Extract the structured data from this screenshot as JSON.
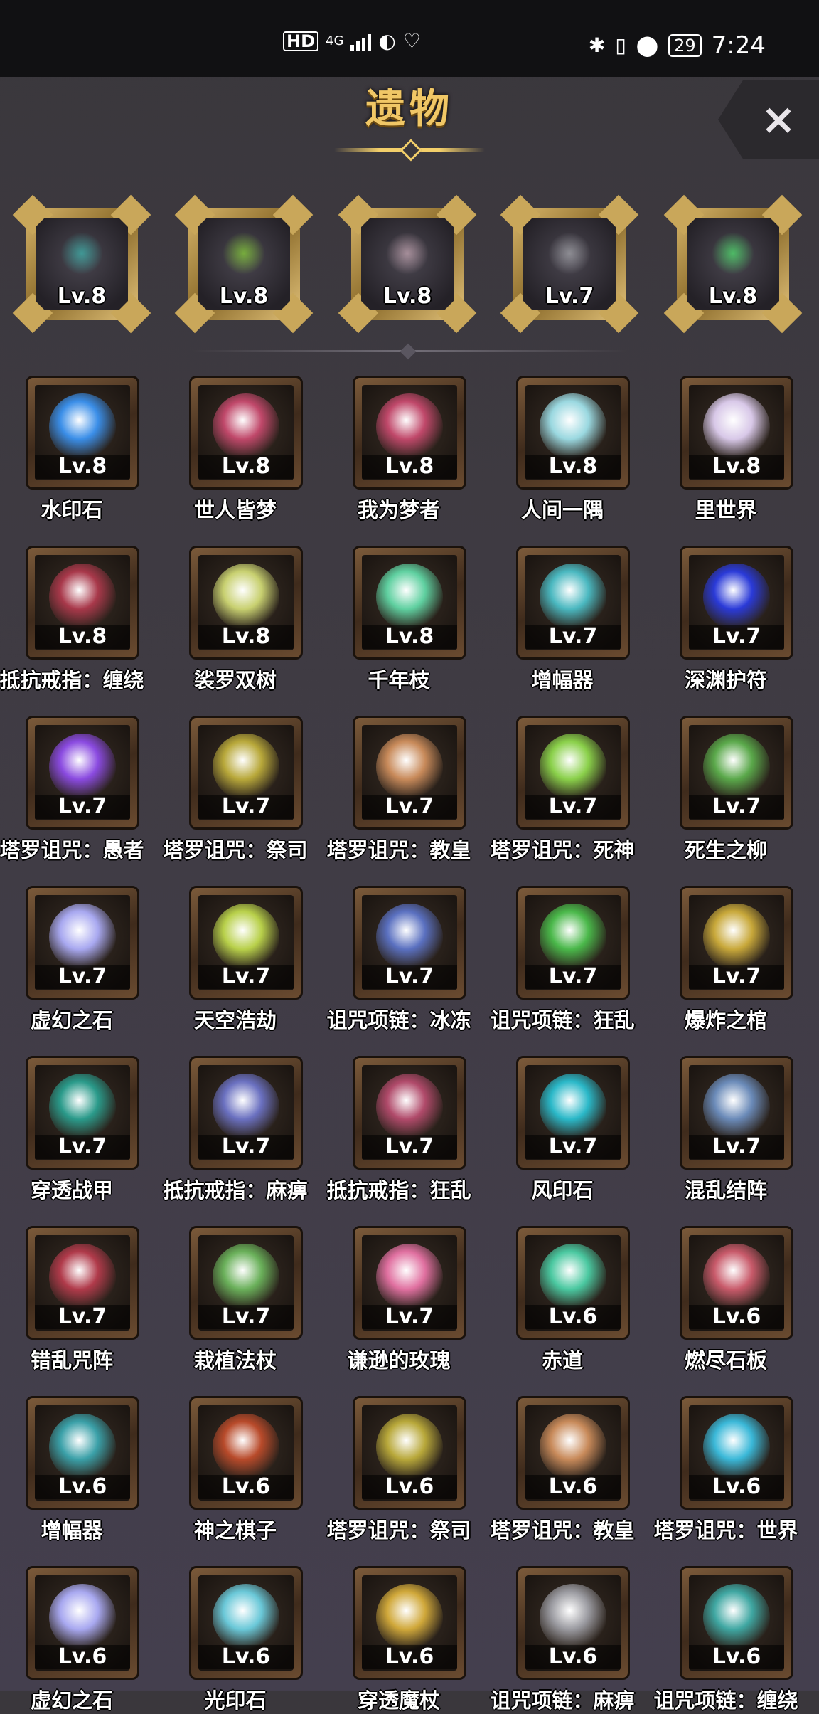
{
  "status_bar": {
    "left": [
      "HD",
      "4G",
      "signal-icon",
      "globe-icon",
      "heart-icon"
    ],
    "battery": "29",
    "time": "7:24"
  },
  "header": {
    "title": "遗物",
    "close_label": "×"
  },
  "equipped": [
    {
      "level": "Lv.8",
      "icon": "cross-necklace-icon",
      "color": "#3fa7a2"
    },
    {
      "level": "Lv.8",
      "icon": "green-staff-icon",
      "color": "#7fbf3a"
    },
    {
      "level": "Lv.8",
      "icon": "thorn-branch-icon",
      "color": "#b79ca8"
    },
    {
      "level": "Lv.7",
      "icon": "chain-necklace-icon",
      "color": "#9a9aa0"
    },
    {
      "level": "Lv.8",
      "icon": "green-gem-pendant-icon",
      "color": "#4fd06a"
    }
  ],
  "relics": [
    {
      "level": "Lv.8",
      "name": "水印石",
      "color": "#3a8ee8"
    },
    {
      "level": "Lv.8",
      "name": "世人皆梦",
      "color": "#c0486a"
    },
    {
      "level": "Lv.8",
      "name": "我为梦者",
      "color": "#c0486a"
    },
    {
      "level": "Lv.8",
      "name": "人间一隅",
      "color": "#9ad8e0"
    },
    {
      "level": "Lv.8",
      "name": "里世界",
      "color": "#d8c8e8"
    },
    {
      "level": "Lv.8",
      "name": "抵抗戒指：缠绕",
      "color": "#a8384a"
    },
    {
      "level": "Lv.8",
      "name": "裟罗双树",
      "color": "#c8d070"
    },
    {
      "level": "Lv.8",
      "name": "千年枝",
      "color": "#5fd0a0"
    },
    {
      "level": "Lv.7",
      "name": "增幅器",
      "color": "#4ab8c0"
    },
    {
      "level": "Lv.7",
      "name": "深渊护符",
      "color": "#2a3ad8"
    },
    {
      "level": "Lv.7",
      "name": "塔罗诅咒：愚者",
      "color": "#8a4ae0"
    },
    {
      "level": "Lv.7",
      "name": "塔罗诅咒：祭司",
      "color": "#b8a83a"
    },
    {
      "level": "Lv.7",
      "name": "塔罗诅咒：教皇",
      "color": "#c88a5a"
    },
    {
      "level": "Lv.7",
      "name": "塔罗诅咒：死神",
      "color": "#8ad04a"
    },
    {
      "level": "Lv.7",
      "name": "死生之柳",
      "color": "#5aa84a"
    },
    {
      "level": "Lv.7",
      "name": "虚幻之石",
      "color": "#a8a8f0"
    },
    {
      "level": "Lv.7",
      "name": "天空浩劫",
      "color": "#b8d04a"
    },
    {
      "level": "Lv.7",
      "name": "诅咒项链：冰冻",
      "color": "#5a70c0"
    },
    {
      "level": "Lv.7",
      "name": "诅咒项链：狂乱",
      "color": "#4ab84a"
    },
    {
      "level": "Lv.7",
      "name": "爆炸之棺",
      "color": "#c8a83a"
    },
    {
      "level": "Lv.7",
      "name": "穿透战甲",
      "color": "#2a9a8a"
    },
    {
      "level": "Lv.7",
      "name": "抵抗戒指：麻痹",
      "color": "#6a70c0"
    },
    {
      "level": "Lv.7",
      "name": "抵抗戒指：狂乱",
      "color": "#b04a6a"
    },
    {
      "level": "Lv.7",
      "name": "风印石",
      "color": "#2ab8c8"
    },
    {
      "level": "Lv.7",
      "name": "混乱结阵",
      "color": "#6a8ab8"
    },
    {
      "level": "Lv.7",
      "name": "错乱咒阵",
      "color": "#b03a4a"
    },
    {
      "level": "Lv.7",
      "name": "栽植法杖",
      "color": "#6ab05a"
    },
    {
      "level": "Lv.7",
      "name": "谦逊的玫瑰",
      "color": "#e070a0"
    },
    {
      "level": "Lv.6",
      "name": "赤道",
      "color": "#4ac8a0"
    },
    {
      "level": "Lv.6",
      "name": "燃尽石板",
      "color": "#c85a6a"
    },
    {
      "level": "Lv.6",
      "name": "增幅器",
      "color": "#3aa0a8"
    },
    {
      "level": "Lv.6",
      "name": "神之棋子",
      "color": "#b84a2a"
    },
    {
      "level": "Lv.6",
      "name": "塔罗诅咒：祭司",
      "color": "#b8a83a"
    },
    {
      "level": "Lv.6",
      "name": "塔罗诅咒：教皇",
      "color": "#c88a5a"
    },
    {
      "level": "Lv.6",
      "name": "塔罗诅咒：世界",
      "color": "#3ab8d8"
    },
    {
      "level": "Lv.6",
      "name": "虚幻之石",
      "color": "#a8a8f0"
    },
    {
      "level": "Lv.6",
      "name": "光印石",
      "color": "#6ac8d8"
    },
    {
      "level": "Lv.6",
      "name": "穿透魔杖",
      "color": "#d0a83a"
    },
    {
      "level": "Lv.6",
      "name": "诅咒项链：麻痹",
      "color": "#9a9aa0"
    },
    {
      "level": "Lv.6",
      "name": "诅咒项链：缠绕",
      "color": "#3fa7a2"
    }
  ]
}
